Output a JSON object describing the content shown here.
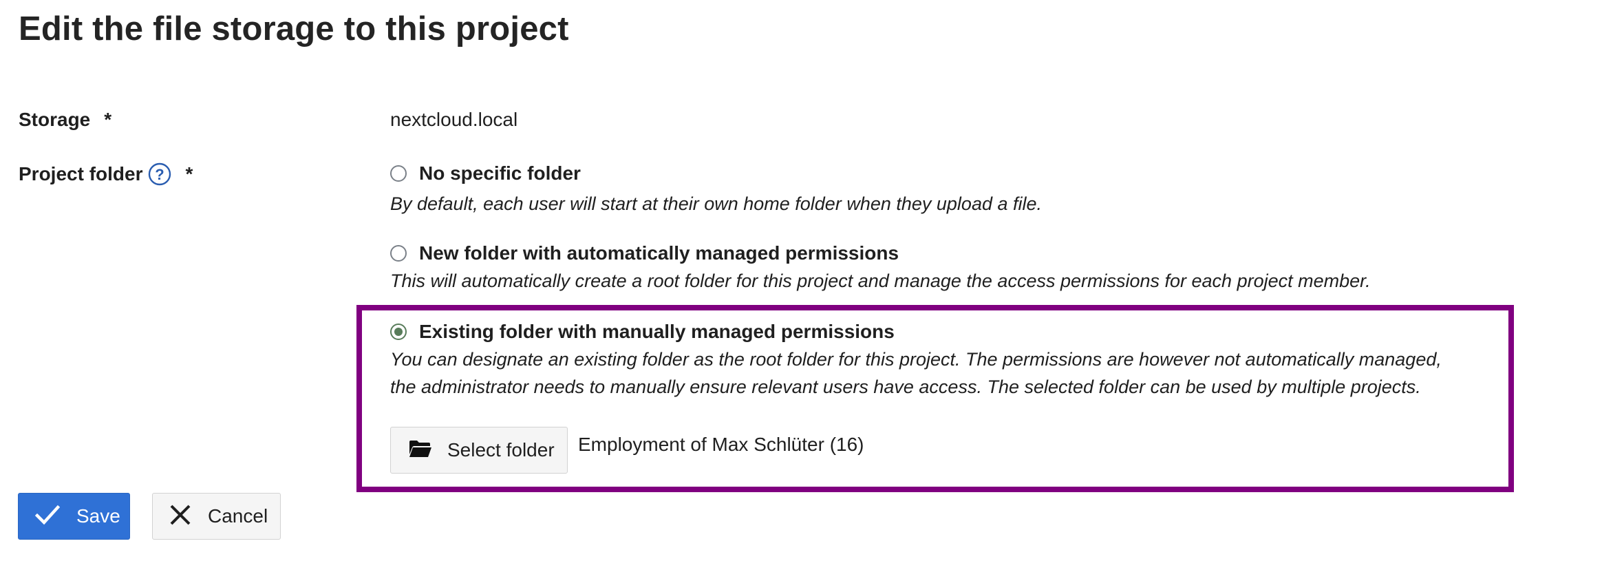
{
  "page": {
    "title": "Edit the file storage to this project"
  },
  "storage": {
    "label": "Storage",
    "required_mark": "*",
    "value": "nextcloud.local"
  },
  "project_folder": {
    "label": "Project folder",
    "required_mark": "*",
    "help_icon": "question-circle-icon",
    "options": [
      {
        "label": "No specific folder",
        "description": "By default, each user will start at their own home folder when they upload a file.",
        "selected": false
      },
      {
        "label": "New folder with automatically managed permissions",
        "description": "This will automatically create a root folder for this project and manage the access permissions for each project member.",
        "selected": false
      },
      {
        "label": "Existing folder with manually managed permissions",
        "description_line1": "You can designate an existing folder as the root folder for this project. The permissions are however not automatically managed,",
        "description_line2": "the administrator needs to manually ensure relevant users have access. The selected folder can be used by multiple projects.",
        "selected": true
      }
    ],
    "select_folder_label": "Select folder",
    "select_folder_icon": "folder-open-icon",
    "selected_folder": "Employment of Max Schlüter (16)"
  },
  "actions": {
    "save_label": "Save",
    "save_icon": "checkmark-icon",
    "cancel_label": "Cancel",
    "cancel_icon": "close-icon"
  },
  "colors": {
    "primary": "#2f71d6",
    "highlight": "#800080",
    "radio_checked": "#587c5a"
  }
}
